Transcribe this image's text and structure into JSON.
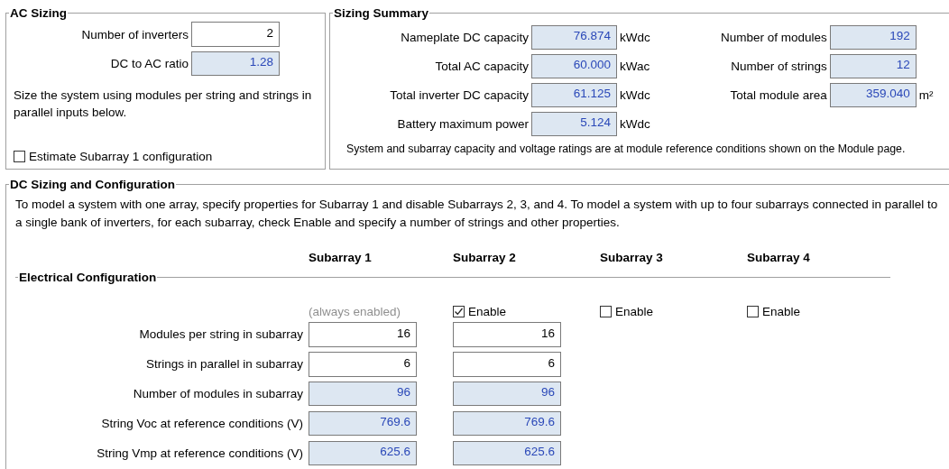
{
  "ac_sizing": {
    "title": "AC Sizing",
    "fields": [
      {
        "label": "Number of inverters",
        "value": "2",
        "kind": "input"
      },
      {
        "label": "DC to AC ratio",
        "value": "1.28",
        "kind": "computed"
      }
    ],
    "note": "Size the system using modules per string and strings in parallel inputs below.",
    "estimate_checkbox": {
      "label": "Estimate Subarray 1 configuration",
      "checked": false
    }
  },
  "sizing_summary": {
    "title": "Sizing Summary",
    "left": [
      {
        "label": "Nameplate DC capacity",
        "value": "76.874",
        "unit": "kWdc"
      },
      {
        "label": "Total AC capacity",
        "value": "60.000",
        "unit": "kWac"
      },
      {
        "label": "Total inverter DC capacity",
        "value": "61.125",
        "unit": "kWdc"
      },
      {
        "label": "Battery maximum power",
        "value": "5.124",
        "unit": "kWdc"
      }
    ],
    "right": [
      {
        "label": "Number of modules",
        "value": "192"
      },
      {
        "label": "Number of strings",
        "value": "12"
      },
      {
        "label": "Total module area",
        "value": "359.040",
        "unit": "m²"
      }
    ],
    "note": "System and subarray capacity and voltage ratings are at module reference conditions shown on the Module page."
  },
  "dc_sizing": {
    "title": "DC Sizing and Configuration",
    "description": "To model a system with one array, specify properties for Subarray 1 and disable Subarrays 2, 3, and 4.  To model a system with up to four subarrays connected in parallel to a single bank of inverters, for each subarray, check Enable and specify a number of strings and other properties.",
    "electrical": {
      "title": "Electrical Configuration",
      "subarrays": [
        {
          "name": "Subarray 1",
          "kind": "fixed",
          "status": "(always enabled)"
        },
        {
          "name": "Subarray 2",
          "kind": "toggle",
          "enable_label": "Enable",
          "checked": true
        },
        {
          "name": "Subarray 3",
          "kind": "toggle",
          "enable_label": "Enable",
          "checked": false
        },
        {
          "name": "Subarray 4",
          "kind": "toggle",
          "enable_label": "Enable",
          "checked": false
        }
      ],
      "rows": [
        {
          "label": "Modules per string in subarray",
          "kind": "input",
          "values": [
            "16",
            "16"
          ]
        },
        {
          "label": "Strings in parallel in subarray",
          "kind": "input",
          "values": [
            "6",
            "6"
          ]
        },
        {
          "label": "Number of modules in subarray",
          "kind": "computed",
          "values": [
            "96",
            "96"
          ]
        },
        {
          "label": "String Voc at reference conditions (V)",
          "kind": "computed",
          "values": [
            "769.6",
            "769.6"
          ]
        },
        {
          "label": "String Vmp at reference conditions (V)",
          "kind": "computed",
          "values": [
            "625.6",
            "625.6"
          ]
        }
      ]
    }
  }
}
